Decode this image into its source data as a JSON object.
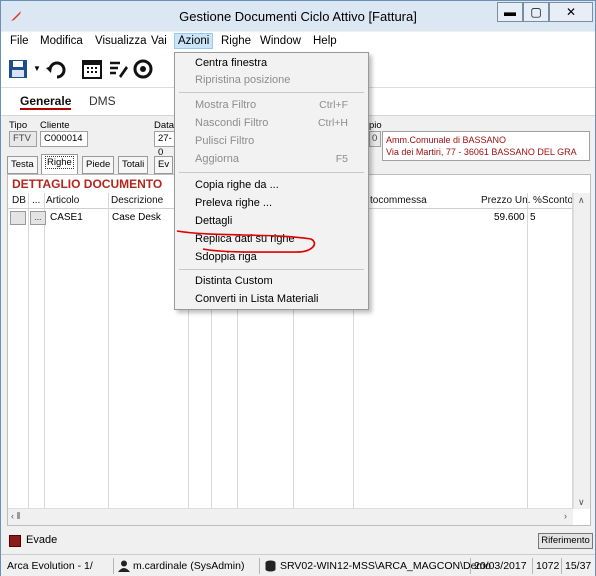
{
  "window": {
    "title": "Gestione Documenti Ciclo Attivo [Fattura]",
    "minimize": "▬",
    "maximize": "▢",
    "close": "✕"
  },
  "menubar": [
    "File",
    "Modifica",
    "Visualizza",
    "Vai",
    "Azioni",
    "Righe",
    "Window",
    "Help"
  ],
  "ribbon": {
    "generale": "Generale",
    "dms": "DMS"
  },
  "header": {
    "tipo_label": "Tipo",
    "cliente_label": "Cliente",
    "data_label": "Data",
    "tipo_value": "FTV",
    "cliente_value": "C000014",
    "data_value": "27-0",
    "dest_label": "pio",
    "dest_code": "0",
    "addr_line1": "Amm.Comunale di BASSANO",
    "addr_line2": "Via dei Martiri, 77 - 36061 BASSANO DEL GRA"
  },
  "tabs": [
    "Testa",
    "Righe",
    "Piede",
    "Totali",
    "Ev"
  ],
  "detail": {
    "title": "DETTAGLIO DOCUMENTO",
    "columns": {
      "db": "DB",
      "dots": "...",
      "articolo": "Articolo",
      "descrizione": "Descrizione",
      "sottocommessa": "tocommessa",
      "prezzo": "Prezzo Un.",
      "sconto": "%Sconto"
    },
    "rows": [
      {
        "articolo": "CASE1",
        "descrizione": "Case Desk",
        "prezzo": "59.600",
        "sconto": "5"
      }
    ]
  },
  "legend": {
    "evade": "Evade",
    "riferimento": "Riferimento"
  },
  "status": {
    "app": "Arca Evolution - 1/",
    "user": "m.cardinale (SysAdmin)",
    "server": "SRV02-WIN12-MSS\\ARCA_MAGCON\\Demo",
    "date": "20/03/2017",
    "n1": "1072",
    "pages": "15/37"
  },
  "menu": {
    "centra": "Centra finestra",
    "ripristina": "Ripristina posizione",
    "mostra": "Mostra Filtro",
    "mostra_sc": "Ctrl+F",
    "nascondi": "Nascondi Filtro",
    "nascondi_sc": "Ctrl+H",
    "pulisci": "Pulisci Filtro",
    "aggiorna": "Aggiorna",
    "aggiorna_sc": "F5",
    "copia": "Copia righe da ...",
    "preleva": "Preleva righe ...",
    "dettagli": "Dettagli",
    "replica": "Replica dati su righe",
    "sdoppia": "Sdoppia riga",
    "distinta": "Distinta Custom",
    "converti": "Converti in Lista Materiali"
  },
  "colors": {
    "accent_red": "#b3261e",
    "evade_swatch": "#8b1a1a",
    "annotation_red": "#e00000"
  }
}
